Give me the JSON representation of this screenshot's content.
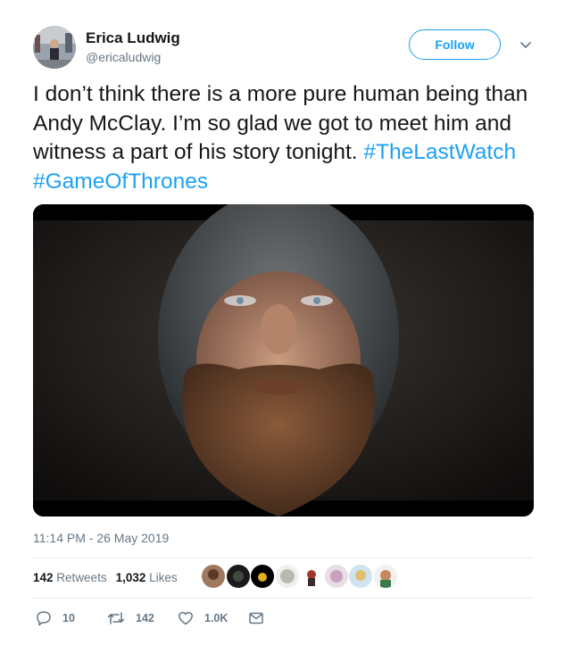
{
  "user": {
    "name": "Erica Ludwig",
    "handle": "@ericaludwig"
  },
  "follow": {
    "label": "Follow"
  },
  "tweet": {
    "text_parts": [
      "I don’t think there is a more pure human being than Andy McClay. I’m so glad we got to meet him and witness a part of his story tonight.  "
    ],
    "hashtags": [
      "#TheLastWatch",
      "#GameOfThrones"
    ]
  },
  "timestamp": "11:14 PM - 26 May 2019",
  "stats": {
    "retweets_count": "142",
    "retweets_label": "Retweets",
    "likes_count": "1,032",
    "likes_label": "Likes"
  },
  "actions": {
    "reply_count": "10",
    "retweet_count": "142",
    "like_count": "1.0K"
  },
  "colors": {
    "accent": "#1da1f2",
    "secondary_text": "#657786",
    "primary_text": "#14171a"
  }
}
